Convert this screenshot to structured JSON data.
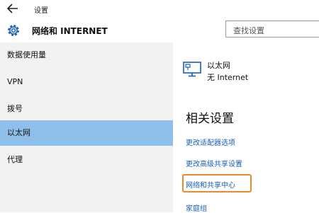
{
  "window": {
    "title": "设置"
  },
  "header": {
    "title": "网络和 INTERNET",
    "search_placeholder": "查找设置"
  },
  "sidebar": {
    "items": [
      {
        "label": "数据使用量"
      },
      {
        "label": "VPN"
      },
      {
        "label": "拨号"
      },
      {
        "label": "以太网",
        "selected": true
      },
      {
        "label": "代理"
      }
    ]
  },
  "main": {
    "connection": {
      "name": "以太网",
      "status": "无 Internet",
      "icon": "ethernet-monitor-icon"
    },
    "related_title": "相关设置",
    "links": [
      {
        "label": "更改适配器选项"
      },
      {
        "label": "更改高级共享设置"
      },
      {
        "label": "网络和共享中心",
        "highlighted": true
      },
      {
        "label": "家庭组"
      }
    ]
  },
  "colors": {
    "selected_nav": "#8ec0eb",
    "link": "#1a5fb4",
    "highlight_border": "#ee8a2b",
    "sidebar_bg": "#f2f2f2"
  }
}
